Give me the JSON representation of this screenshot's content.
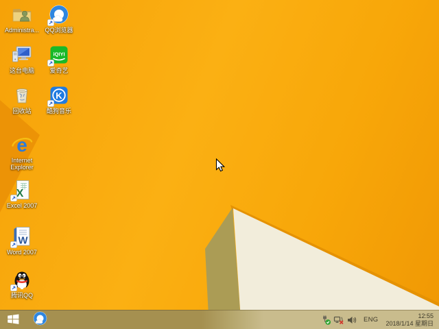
{
  "colors": {
    "wallpaper_orange": "#F8A70B",
    "wallpaper_dark_facet": "#EC9306",
    "wallpaper_cream": "#F2EDDB",
    "wallpaper_olive": "#AB9C55",
    "taskbar_left": "#A59050",
    "taskbar_right": "#C9BC8D",
    "icon_label_color": "#FFFFFF",
    "tray_text_color": "#3E3A2A"
  },
  "desktop": {
    "icons": [
      {
        "id": "admin-folder",
        "label": "Administra...",
        "shortcut": false
      },
      {
        "id": "qq-browser",
        "label": "QQ浏览器",
        "shortcut": true
      },
      {
        "id": "this-pc",
        "label": "这台电脑",
        "shortcut": false
      },
      {
        "id": "iqiyi",
        "label": "爱奇艺",
        "shortcut": true,
        "glyph": "iQIYI"
      },
      {
        "id": "recycle-bin",
        "label": "回收站",
        "shortcut": false
      },
      {
        "id": "kugou-music",
        "label": "酷狗音乐",
        "shortcut": true,
        "glyph": "K"
      },
      {
        "id": "internet-explorer",
        "label": "Internet Explorer",
        "shortcut": false,
        "glyph": "e"
      },
      {
        "id": "excel-2007",
        "label": "Excel 2007",
        "shortcut": true,
        "glyph": "X"
      },
      {
        "id": "word-2007",
        "label": "Word 2007",
        "shortcut": true,
        "glyph": "W"
      },
      {
        "id": "tencent-qq",
        "label": "腾讯QQ",
        "shortcut": true
      }
    ]
  },
  "taskbar": {
    "pinned_icons": [
      "windows-start",
      "qq-browser"
    ],
    "tray": {
      "status_icons": [
        "usb-safely-remove",
        "network-disconnected",
        "volume"
      ],
      "language_indicator": "ENG",
      "time": "12:55",
      "date": "2018/1/14 星期日"
    }
  }
}
